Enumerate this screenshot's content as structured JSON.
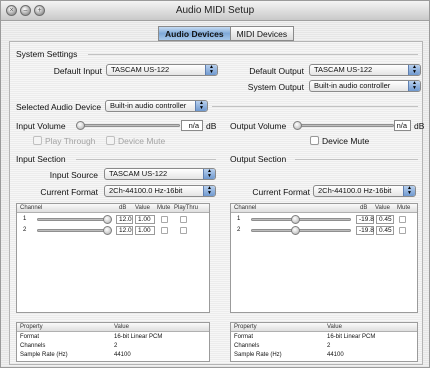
{
  "window": {
    "title": "Audio MIDI Setup"
  },
  "tabs": [
    {
      "label": "Audio Devices",
      "selected": true
    },
    {
      "label": "MIDI Devices",
      "selected": false
    }
  ],
  "system_settings": {
    "heading": "System Settings",
    "default_input_label": "Default Input",
    "default_input_value": "TASCAM US-122",
    "default_output_label": "Default Output",
    "default_output_value": "TASCAM US-122",
    "system_output_label": "System Output",
    "system_output_value": "Built-in audio controller"
  },
  "device": {
    "selected_label": "Selected Audio Device",
    "selected_value": "Built-in audio controller",
    "input_volume_label": "Input Volume",
    "input_volume_value": "n/a",
    "output_volume_label": "Output Volume",
    "output_volume_value": "n/a",
    "db_unit": "dB",
    "play_through_label": "Play Through",
    "device_mute_label": "Device Mute"
  },
  "input_section": {
    "heading": "Input Section",
    "source_label": "Input Source",
    "source_value": "TASCAM US-122",
    "format_label": "Current Format",
    "format_value": "2Ch-44100.0 Hz-16bit",
    "columns": [
      "Channel",
      "dB",
      "Value",
      "Mute",
      "PlayThru"
    ],
    "channels": [
      {
        "num": "1",
        "db": "12.0",
        "value": "1.00",
        "level": 1.0
      },
      {
        "num": "2",
        "db": "12.0",
        "value": "1.00",
        "level": 1.0
      }
    ],
    "property_columns": [
      "Property",
      "Value"
    ],
    "properties": [
      {
        "name": "Format",
        "value": "16-bit Linear PCM"
      },
      {
        "name": "Channels",
        "value": "2"
      },
      {
        "name": "Sample Rate (Hz)",
        "value": "44100"
      }
    ]
  },
  "output_section": {
    "heading": "Output Section",
    "format_label": "Current Format",
    "format_value": "2Ch-44100.0 Hz-16bit",
    "columns": [
      "Channel",
      "dB",
      "Value",
      "Mute"
    ],
    "channels": [
      {
        "num": "1",
        "db": "-19.8",
        "value": "0.45",
        "level": 0.45
      },
      {
        "num": "2",
        "db": "-19.8",
        "value": "0.45",
        "level": 0.45
      }
    ],
    "property_columns": [
      "Property",
      "Value"
    ],
    "properties": [
      {
        "name": "Format",
        "value": "16-bit Linear PCM"
      },
      {
        "name": "Channels",
        "value": "2"
      },
      {
        "name": "Sample Rate (Hz)",
        "value": "44100"
      }
    ]
  }
}
